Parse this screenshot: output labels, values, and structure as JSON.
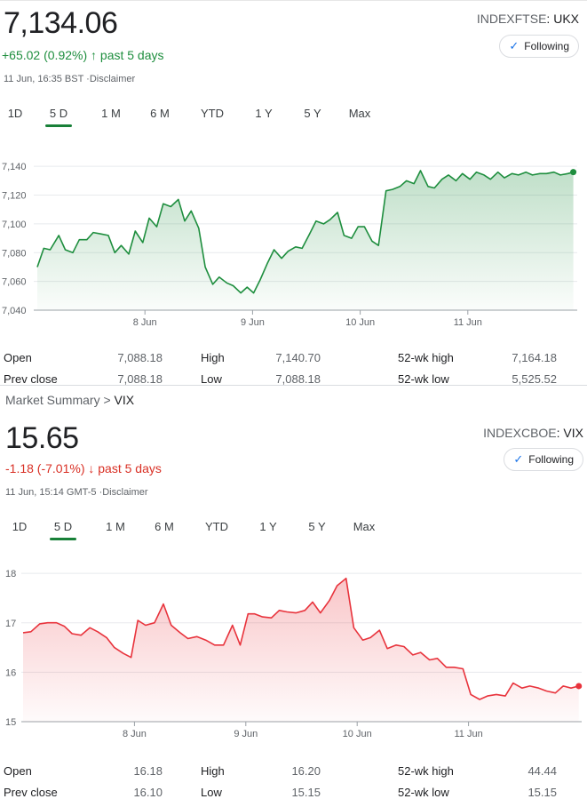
{
  "ftse": {
    "price": "7,134.06",
    "change": "+65.02 (0.92%)",
    "change_arrow": "↑",
    "period": "past 5 days",
    "timestamp": "11 Jun, 16:35 BST ·Disclaimer",
    "exchange": "INDEXFTSE",
    "symbol": "UKX",
    "follow_label": "Following",
    "tabs": [
      "1D",
      "5 D",
      "1 M",
      "6 M",
      "YTD",
      "1 Y",
      "5 Y",
      "Max"
    ],
    "active_tab": "5 D",
    "color": "#1e8e3e",
    "stats": [
      {
        "label": "Open",
        "value": "7,088.18",
        "label2": "High",
        "value2": "7,140.70",
        "label3": "52-wk high",
        "value3": "7,164.18"
      },
      {
        "label": "Prev close",
        "value": "7,088.18",
        "label2": "Low",
        "value2": "7,088.18",
        "label3": "52-wk low",
        "value3": "5,525.52"
      }
    ]
  },
  "vix": {
    "breadcrumb_root": "Market Summary",
    "breadcrumb_sep": ">",
    "breadcrumb_current": "VIX",
    "price": "15.65",
    "change": "-1.18 (-7.01%)",
    "change_arrow": "↓",
    "period": "past 5 days",
    "timestamp": "11 Jun, 15:14 GMT-5 ·Disclaimer",
    "exchange": "INDEXCBOE",
    "symbol": "VIX",
    "follow_label": "Following",
    "tabs": [
      "1D",
      "5 D",
      "1 M",
      "6 M",
      "YTD",
      "1 Y",
      "5 Y",
      "Max"
    ],
    "active_tab": "5 D",
    "color": "#e8333c",
    "stats": [
      {
        "label": "Open",
        "value": "16.18",
        "label2": "High",
        "value2": "16.20",
        "label3": "52-wk high",
        "value3": "44.44"
      },
      {
        "label": "Prev close",
        "value": "16.10",
        "label2": "Low",
        "value2": "15.15",
        "label3": "52-wk low",
        "value3": "15.15"
      }
    ]
  },
  "chart_data": [
    {
      "type": "line",
      "title": "",
      "xlabel": "",
      "ylabel": "",
      "ylim": [
        7040,
        7150
      ],
      "y_ticks": [
        "7,140",
        "7,120",
        "7,100",
        "7,080",
        "7,060",
        "7,040"
      ],
      "y_tick_values": [
        7140,
        7120,
        7100,
        7080,
        7060,
        7040
      ],
      "x_ticks": [
        "8 Jun",
        "9 Jun",
        "10 Jun",
        "11 Jun"
      ],
      "x_tick_positions": [
        1,
        2,
        3,
        4
      ],
      "xlim": [
        0,
        5
      ],
      "grid": true,
      "series": [
        {
          "x": [
            0,
            0.06,
            0.12,
            0.2,
            0.26,
            0.33,
            0.39,
            0.46,
            0.52,
            0.59,
            0.66,
            0.72,
            0.78,
            0.85,
            0.91,
            0.98,
            1.04,
            1.11,
            1.17,
            1.24,
            1.31,
            1.37,
            1.43,
            1.5,
            1.56,
            1.63,
            1.69,
            1.76,
            1.82,
            1.89,
            1.95,
            2.01,
            2.07,
            2.14,
            2.2,
            2.27,
            2.33,
            2.4,
            2.46,
            2.53,
            2.59,
            2.66,
            2.72,
            2.79,
            2.85,
            2.92,
            2.98,
            3.04,
            3.11,
            3.17,
            3.24,
            3.3,
            3.37,
            3.43,
            3.5,
            3.56,
            3.63,
            3.69,
            3.76,
            3.82,
            3.89,
            3.95,
            4.02,
            4.08,
            4.15,
            4.21,
            4.28,
            4.34,
            4.41,
            4.47,
            4.54,
            4.6,
            4.67,
            4.73,
            4.8,
            4.86,
            4.93,
            4.98
          ],
          "values": [
            7070,
            7083,
            7082,
            7092,
            7082,
            7080,
            7089,
            7089,
            7094,
            7093,
            7092,
            7080,
            7085,
            7079,
            7095,
            7087,
            7104,
            7098,
            7114,
            7112,
            7117,
            7102,
            7109,
            7097,
            7070,
            7058,
            7063,
            7059,
            7057,
            7052,
            7056,
            7052,
            7061,
            7073,
            7082,
            7076,
            7081,
            7084,
            7083,
            7093,
            7102,
            7100,
            7103,
            7108,
            7092,
            7090,
            7098,
            7098,
            7088,
            7085,
            7123,
            7124,
            7126,
            7130,
            7128,
            7137,
            7126,
            7125,
            7131,
            7134,
            7130,
            7135,
            7131,
            7136,
            7134,
            7131,
            7136,
            7132,
            7135,
            7134,
            7136,
            7134,
            7135,
            7135,
            7136,
            7134,
            7135,
            7136
          ]
        }
      ]
    },
    {
      "type": "line",
      "title": "",
      "xlabel": "",
      "ylabel": "",
      "ylim": [
        15,
        18.2
      ],
      "y_ticks": [
        "18",
        "17",
        "16",
        "15"
      ],
      "y_tick_values": [
        18,
        17,
        16,
        15
      ],
      "x_ticks": [
        "8 Jun",
        "9 Jun",
        "10 Jun",
        "11 Jun"
      ],
      "x_tick_positions": [
        1,
        2,
        3,
        4
      ],
      "xlim": [
        0,
        5
      ],
      "grid": true,
      "series": [
        {
          "x": [
            0,
            0.07,
            0.15,
            0.22,
            0.3,
            0.37,
            0.44,
            0.52,
            0.6,
            0.67,
            0.75,
            0.82,
            0.9,
            0.97,
            1.03,
            1.1,
            1.18,
            1.26,
            1.33,
            1.41,
            1.48,
            1.56,
            1.64,
            1.72,
            1.8,
            1.88,
            1.95,
            2.02,
            2.08,
            2.15,
            2.23,
            2.3,
            2.37,
            2.45,
            2.53,
            2.6,
            2.67,
            2.75,
            2.82,
            2.9,
            2.97,
            3.05,
            3.12,
            3.2,
            3.27,
            3.35,
            3.42,
            3.5,
            3.57,
            3.65,
            3.72,
            3.8,
            3.87,
            3.95,
            4.02,
            4.1,
            4.17,
            4.25,
            4.33,
            4.4,
            4.48,
            4.55,
            4.63,
            4.7,
            4.78,
            4.85,
            4.92,
            4.99
          ],
          "values": [
            16.8,
            16.82,
            16.98,
            17.0,
            17.0,
            16.93,
            16.78,
            16.75,
            16.9,
            16.82,
            16.7,
            16.5,
            16.38,
            16.3,
            17.05,
            16.95,
            17.0,
            17.38,
            16.95,
            16.8,
            16.68,
            16.72,
            16.65,
            16.55,
            16.55,
            16.95,
            16.55,
            17.18,
            17.18,
            17.12,
            17.1,
            17.25,
            17.22,
            17.2,
            17.25,
            17.42,
            17.2,
            17.45,
            17.75,
            17.9,
            16.9,
            16.65,
            16.7,
            16.85,
            16.48,
            16.55,
            16.52,
            16.35,
            16.4,
            16.25,
            16.28,
            16.1,
            16.1,
            16.07,
            15.55,
            15.45,
            15.52,
            15.55,
            15.52,
            15.78,
            15.68,
            15.72,
            15.68,
            15.62,
            15.58,
            15.72,
            15.68,
            15.72
          ]
        }
      ]
    }
  ]
}
